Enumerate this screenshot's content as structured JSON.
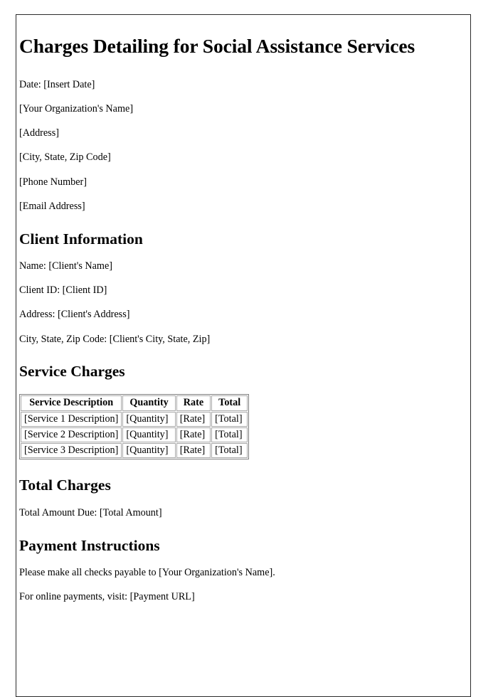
{
  "document": {
    "title": "Charges Detailing for Social Assistance Services",
    "org_block": [
      {
        "line": "Date: [Insert Date]"
      },
      {
        "line": "[Your Organization's Name]"
      },
      {
        "line": "[Address]"
      },
      {
        "line": "[City, State, Zip Code]"
      },
      {
        "line": "[Phone Number]"
      },
      {
        "line": "[Email Address]"
      }
    ],
    "sections": {
      "client_information": {
        "heading": "Client Information",
        "lines": [
          {
            "line": "Name: [Client's Name]"
          },
          {
            "line": "Client ID: [Client ID]"
          },
          {
            "line": "Address: [Client's Address]"
          },
          {
            "line": "City, State, Zip Code: [Client's City, State, Zip]"
          }
        ]
      },
      "service_charges": {
        "heading": "Service Charges",
        "table": {
          "columns": [
            "Service Description",
            "Quantity",
            "Rate",
            "Total"
          ],
          "rows": [
            [
              "[Service 1 Description]",
              "[Quantity]",
              "[Rate]",
              "[Total]"
            ],
            [
              "[Service 2 Description]",
              "[Quantity]",
              "[Rate]",
              "[Total]"
            ],
            [
              "[Service 3 Description]",
              "[Quantity]",
              "[Rate]",
              "[Total]"
            ]
          ]
        }
      },
      "total_charges": {
        "heading": "Total Charges",
        "lines": [
          {
            "line": "Total Amount Due: [Total Amount]"
          }
        ]
      },
      "payment_instructions": {
        "heading": "Payment Instructions",
        "lines": [
          {
            "line": "Please make all checks payable to [Your Organization's Name]."
          },
          {
            "line": "For online payments, visit: [Payment URL]"
          }
        ]
      }
    }
  },
  "colors": {
    "page_background": "#ffffff",
    "text": "#000000",
    "page_border": "#2b2b2b",
    "table_outer_border": "#808080",
    "table_cell_border": "#a9a9a9"
  }
}
